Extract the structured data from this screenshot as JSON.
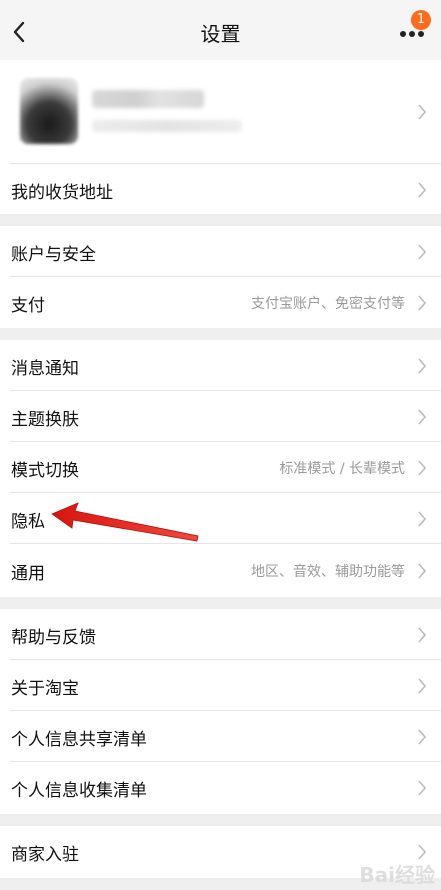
{
  "header": {
    "title": "设置",
    "back_icon": "back-chevron-icon",
    "more_icon": "more-dots-icon",
    "badge_count": "1",
    "badge_color": "#ff6b1a"
  },
  "profile": {
    "avatar": "avatar-blurred",
    "chevron_icon": "chevron-right-icon"
  },
  "rows": {
    "address": {
      "label": "我的收货地址"
    },
    "account_security": {
      "label": "账户与安全"
    },
    "payment": {
      "label": "支付",
      "value": "支付宝账户、免密支付等"
    },
    "notifications": {
      "label": "消息通知"
    },
    "theme": {
      "label": "主题换肤"
    },
    "mode": {
      "label": "模式切换",
      "value": "标准模式 / 长辈模式"
    },
    "privacy": {
      "label": "隐私"
    },
    "general": {
      "label": "通用",
      "value": "地区、音效、辅助功能等"
    },
    "help": {
      "label": "帮助与反馈"
    },
    "about": {
      "label": "关于淘宝"
    },
    "info_share": {
      "label": "个人信息共享清单"
    },
    "info_collect": {
      "label": "个人信息收集清单"
    },
    "merchant": {
      "label": "商家入驻"
    }
  },
  "annotation": {
    "type": "red-arrow",
    "color": "#e8211c",
    "points_to": "隐私"
  },
  "watermark": "Bai经验"
}
